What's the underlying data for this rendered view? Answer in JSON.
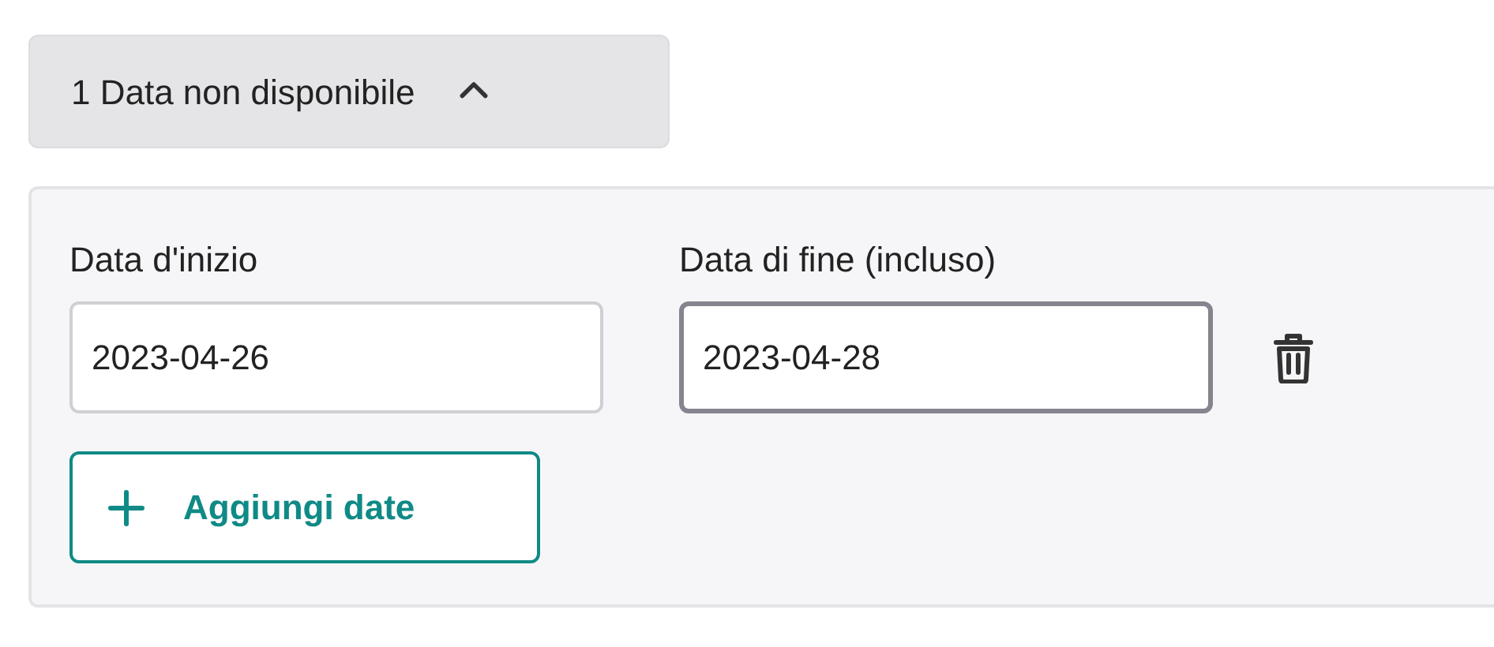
{
  "toggle": {
    "label": "1 Data non disponibile",
    "expanded": true
  },
  "ranges": [
    {
      "start": {
        "label": "Data d'inizio",
        "value": "2023-04-26",
        "focused": false
      },
      "end": {
        "label": "Data di fine (incluso)",
        "value": "2023-04-28",
        "focused": true
      }
    }
  ],
  "add_button": {
    "label": "Aggiungi date"
  }
}
